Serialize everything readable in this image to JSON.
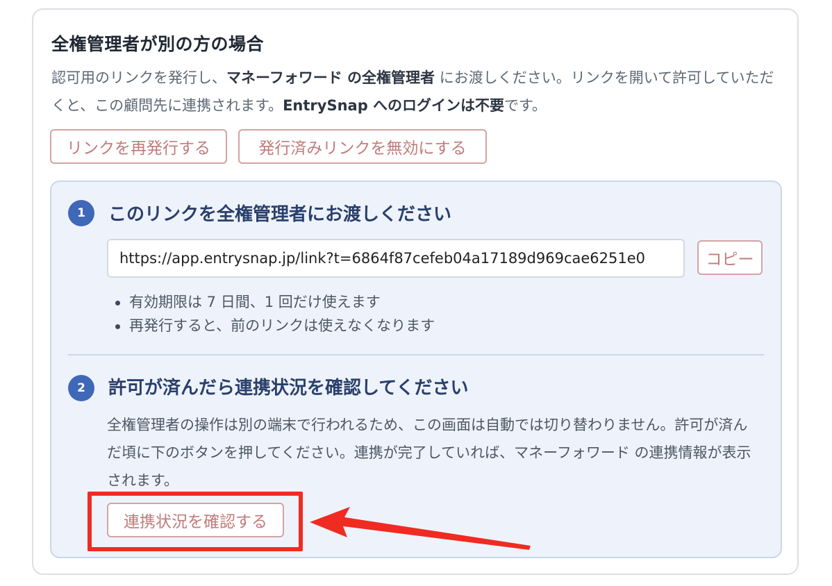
{
  "section": {
    "title": "全権管理者が別の方の場合",
    "description": {
      "p1": "認可用のリンクを発行し、",
      "b1": "マネーフォワード の全権管理者",
      "p2": " にお渡しください。リンクを開いて許可していただくと、この顧問先に連携されます。",
      "b2": "EntrySnap へのログインは不要",
      "p3": "です。"
    },
    "reissue_label": "リンクを再発行する",
    "disable_label": "発行済みリンクを無効にする"
  },
  "step1": {
    "number": "1",
    "title": "このリンクを全権管理者にお渡しください",
    "link_value": "https://app.entrysnap.jp/link?t=6864f87cefeb04a17189d969cae6251e0",
    "copy_label": "コピー",
    "notes": [
      "有効期限は 7 日間、1 回だけ使えます",
      "再発行すると、前のリンクは使えなくなります"
    ]
  },
  "step2": {
    "number": "2",
    "title": "許可が済んだら連携状況を確認してください",
    "description": "全権管理者の操作は別の端末で行われるため、この画面は自動では切り替わりません。許可が済んだ頃に下のボタンを押してください。連携が完了していれば、マネーフォワード の連携情報が表示されます。",
    "check_label": "連携状況を確認する"
  },
  "annotation": {
    "highlight_color": "#f02b22",
    "arrow_color": "#f02b22"
  }
}
